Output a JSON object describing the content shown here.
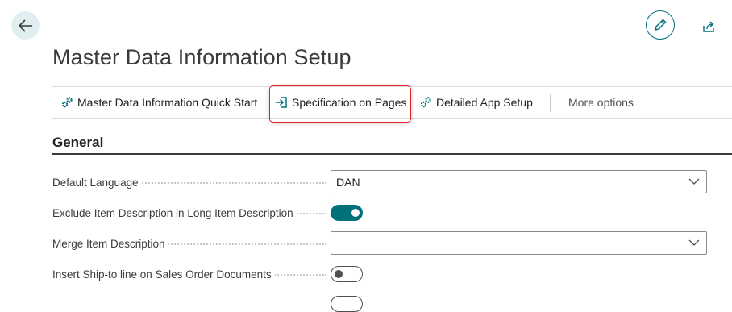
{
  "header": {
    "title": "Master Data Information Setup",
    "back_icon": "arrow-left-icon",
    "edit_icon": "pencil-icon",
    "share_icon": "share-icon"
  },
  "actions": [
    {
      "label": "Master Data Information Quick Start",
      "icon": "gears-icon"
    },
    {
      "label": "Specification on Pages",
      "icon": "navigate-into-icon",
      "highlighted": true
    },
    {
      "label": "Detailed App Setup",
      "icon": "gears-icon"
    }
  ],
  "more_options": "More options",
  "section": {
    "title": "General"
  },
  "fields": {
    "default_language": {
      "label": "Default Language",
      "value": "DAN"
    },
    "exclude_item_description": {
      "label": "Exclude Item Description in Long Item Description",
      "value": true
    },
    "merge_item_description": {
      "label": "Merge Item Description",
      "value": ""
    },
    "insert_ship_to": {
      "label": "Insert Ship-to line on Sales Order Documents",
      "value": false
    }
  },
  "colors": {
    "accent": "#00707b",
    "highlight_border": "#e0202a"
  }
}
